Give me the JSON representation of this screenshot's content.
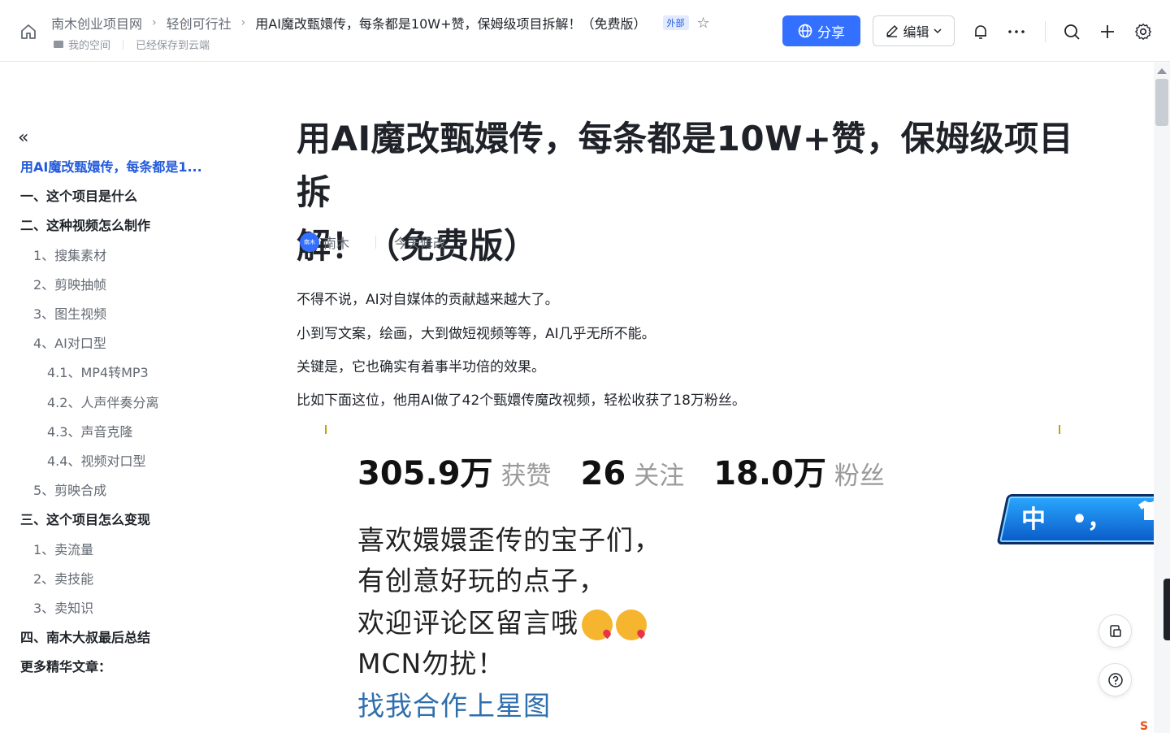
{
  "breadcrumb": {
    "items": [
      "南木创业项目网",
      "轻创可行社",
      "用AI魔改甄嬛传，每条都是10W+赞，保姆级项目拆解！（免费版）"
    ],
    "tag": "外部"
  },
  "subline": {
    "space": "我的空间",
    "save_status": "已经保存到云端"
  },
  "toolbar": {
    "share_label": "分享",
    "edit_label": "编辑"
  },
  "toc": {
    "items": [
      {
        "label": "用AI魔改甄嬛传，每条都是1...",
        "level": 0
      },
      {
        "label": "一、这个项目是什么",
        "level": 1
      },
      {
        "label": "二、这种视频怎么制作",
        "level": 1
      },
      {
        "label": "1、搜集素材",
        "level": 2
      },
      {
        "label": "2、剪映抽帧",
        "level": 2
      },
      {
        "label": "3、图生视频",
        "level": 2
      },
      {
        "label": "4、AI对口型",
        "level": 2
      },
      {
        "label": "4.1、MP4转MP3",
        "level": 3
      },
      {
        "label": "4.2、人声伴奏分离",
        "level": 3
      },
      {
        "label": "4.3、声音克隆",
        "level": 3
      },
      {
        "label": "4.4、视频对口型",
        "level": 3
      },
      {
        "label": "5、剪映合成",
        "level": 2
      },
      {
        "label": "三、这个项目怎么变现",
        "level": 1
      },
      {
        "label": "1、卖流量",
        "level": 2
      },
      {
        "label": "2、卖技能",
        "level": 2
      },
      {
        "label": "3、卖知识",
        "level": 2
      },
      {
        "label": "四、南木大叔最后总结",
        "level": 1
      },
      {
        "label": "更多精华文章：",
        "level": 1
      }
    ]
  },
  "doc": {
    "title_line1": "用AI魔改甄嬛传，每条都是10W+赞，保姆级项目拆",
    "title_line2": "解！（免费版）",
    "author": "南木",
    "avatar_text": "南木",
    "modified": "今天修改",
    "paragraphs": [
      "不得不说，AI对自媒体的贡献越来越大了。",
      "小到写文案，绘画，大到做短视频等等，AI几乎无所不能。",
      "关键是，它也确实有着事半功倍的效果。",
      "比如下面这位，他用AI做了42个甄嬛传魔改视频，轻松收获了18万粉丝。"
    ]
  },
  "embedded_image": {
    "stats": [
      {
        "num": "305.9万",
        "label": "获赞"
      },
      {
        "num": "26",
        "label": "关注"
      },
      {
        "num": "18.0万",
        "label": "粉丝"
      }
    ],
    "bio": [
      "喜欢嬛嬛歪传的宝子们，",
      "有创意好玩的点子，",
      "欢迎评论区留言哦",
      "MCN勿扰！",
      "找我合作上星图"
    ]
  },
  "ime": {
    "label": "中",
    "punct": "•，",
    "skin": "skin"
  }
}
